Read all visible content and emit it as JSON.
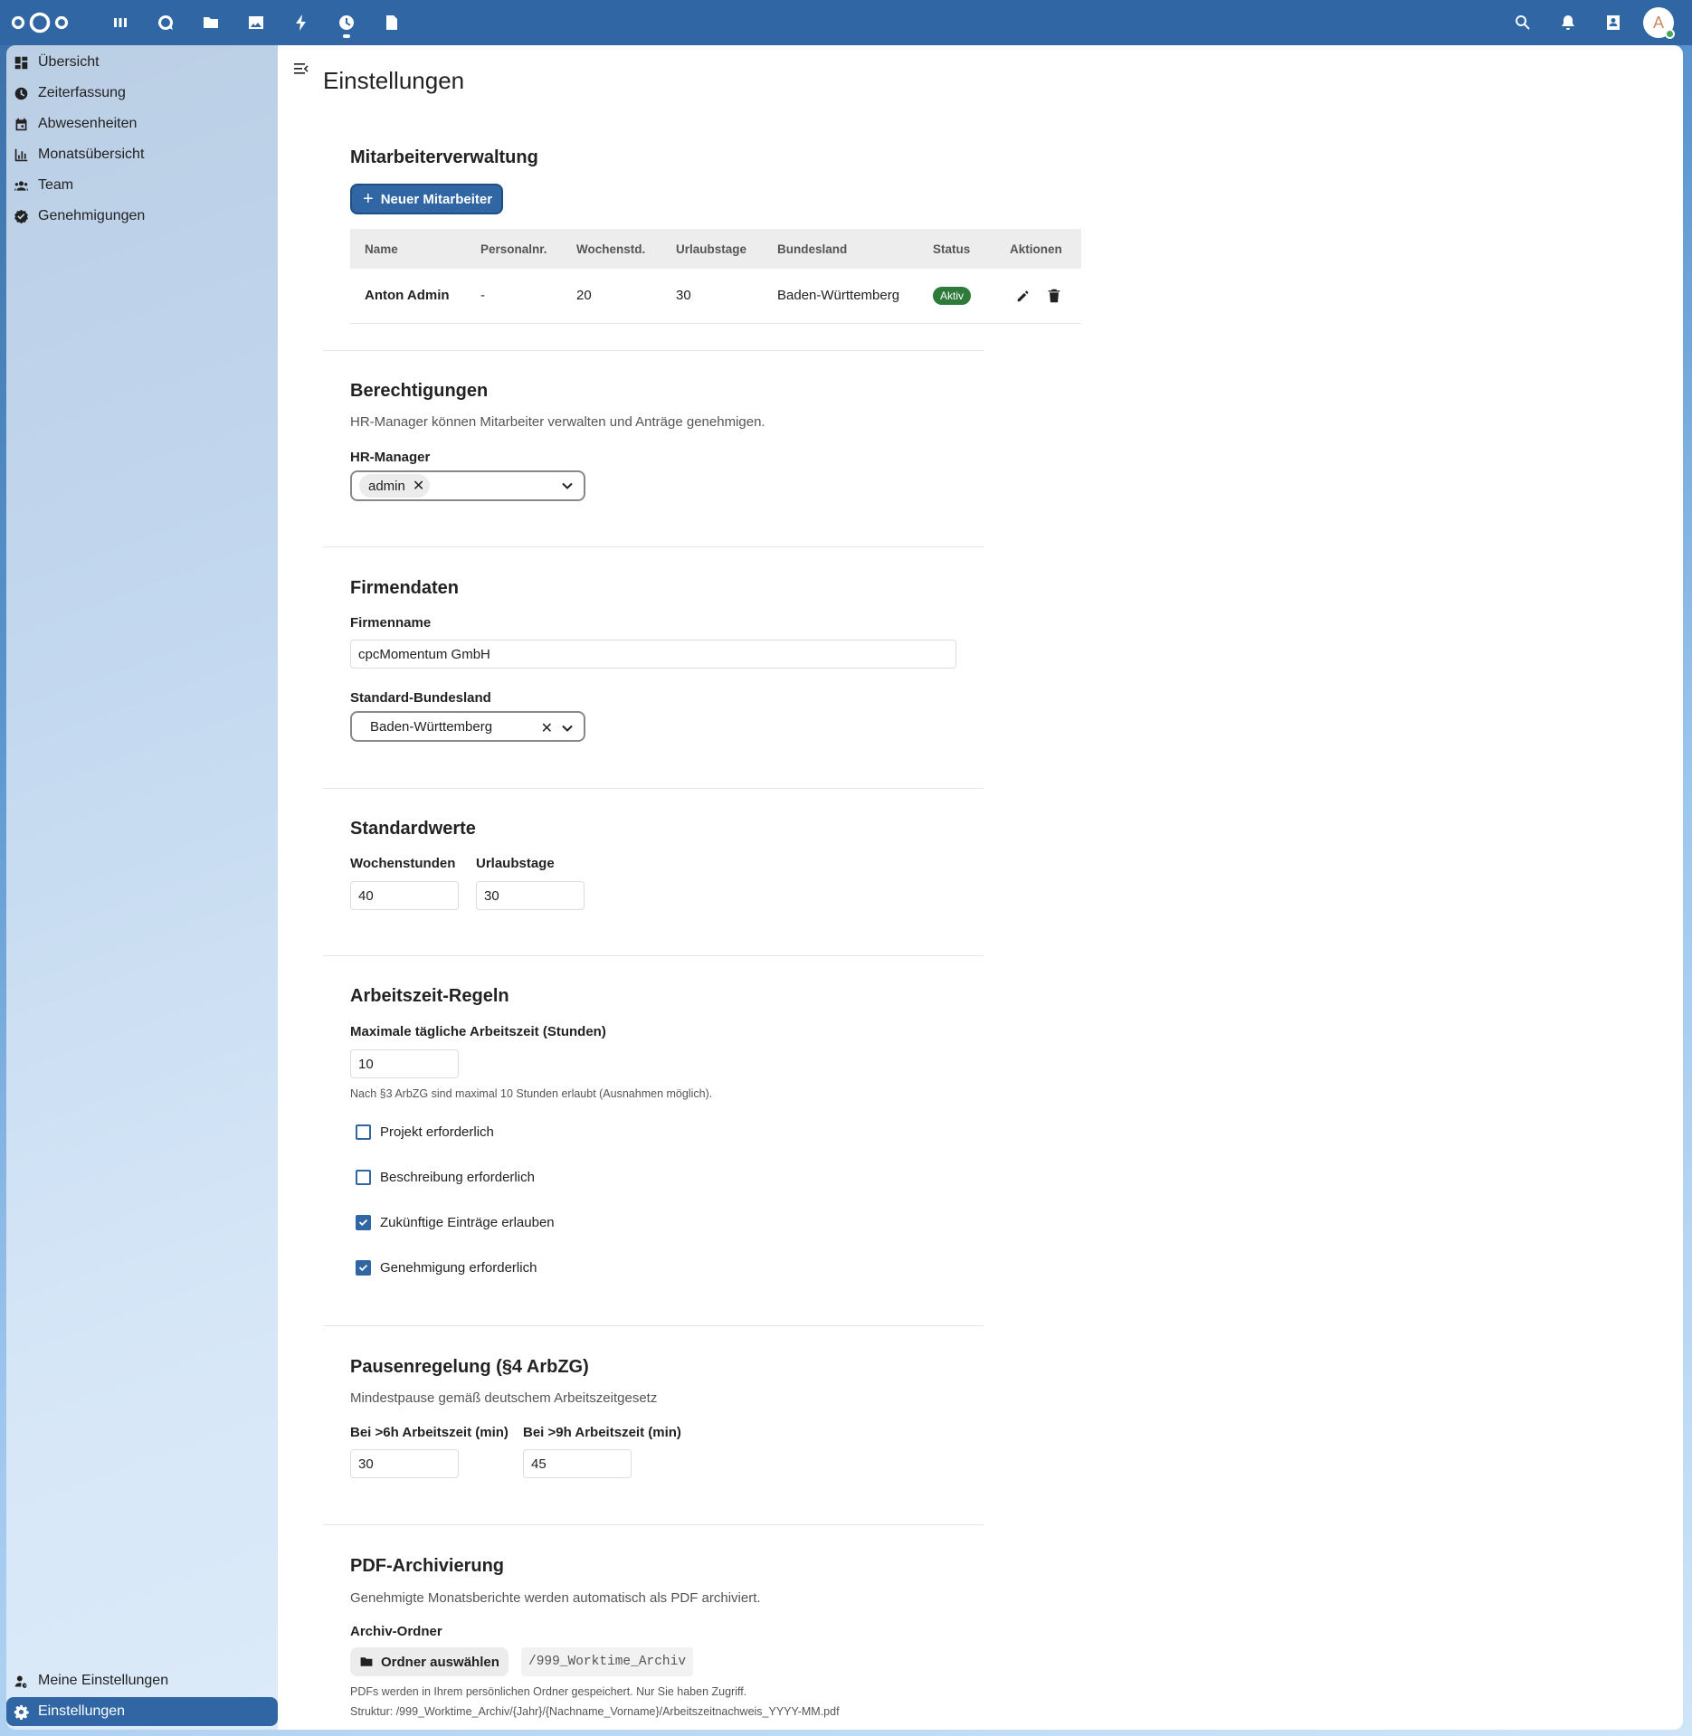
{
  "topbar": {
    "apps": [
      "dashboard-icon",
      "talk-icon",
      "files-icon",
      "photos-icon",
      "activity-icon",
      "timetracking-icon",
      "notes-icon"
    ],
    "active_app": "timetracking-icon",
    "avatar_initial": "A"
  },
  "sidebar": {
    "items": [
      {
        "label": "Übersicht",
        "icon": "dashboard-icon"
      },
      {
        "label": "Zeiterfassung",
        "icon": "clock-icon"
      },
      {
        "label": "Abwesenheiten",
        "icon": "calendar-icon"
      },
      {
        "label": "Monatsübersicht",
        "icon": "chart-icon"
      },
      {
        "label": "Team",
        "icon": "team-icon"
      },
      {
        "label": "Genehmigungen",
        "icon": "approval-icon"
      }
    ],
    "bottom": [
      {
        "label": "Meine Einstellungen",
        "icon": "user-settings-icon"
      },
      {
        "label": "Einstellungen",
        "icon": "gear-icon",
        "active": true
      }
    ]
  },
  "page": {
    "title": "Einstellungen"
  },
  "employees": {
    "title": "Mitarbeiterverwaltung",
    "new_button": "Neuer Mitarbeiter",
    "columns": [
      "Name",
      "Personalnr.",
      "Wochenstd.",
      "Urlaubstage",
      "Bundesland",
      "Status",
      "Aktionen"
    ],
    "rows": [
      {
        "name": "Anton Admin",
        "personalnr": "-",
        "wochenstd": "20",
        "urlaubstage": "30",
        "bundesland": "Baden-Württemberg",
        "status": "Aktiv"
      }
    ]
  },
  "permissions": {
    "title": "Berechtigungen",
    "description": "HR-Manager können Mitarbeiter verwalten und Anträge genehmigen.",
    "hr_label": "HR-Manager",
    "hr_chip": "admin"
  },
  "company": {
    "title": "Firmendaten",
    "name_label": "Firmenname",
    "name_value": "cpcMomentum GmbH",
    "state_label": "Standard-Bundesland",
    "state_value": "Baden-Württemberg"
  },
  "defaults": {
    "title": "Standardwerte",
    "hours_label": "Wochenstunden",
    "hours_value": "40",
    "vacation_label": "Urlaubstage",
    "vacation_value": "30"
  },
  "rules": {
    "title": "Arbeitszeit-Regeln",
    "max_label": "Maximale tägliche Arbeitszeit (Stunden)",
    "max_value": "10",
    "max_hint": "Nach §3 ArbZG sind maximal 10 Stunden erlaubt (Ausnahmen möglich).",
    "checkboxes": [
      {
        "label": "Projekt erforderlich",
        "checked": false
      },
      {
        "label": "Beschreibung erforderlich",
        "checked": false
      },
      {
        "label": "Zukünftige Einträge erlauben",
        "checked": true
      },
      {
        "label": "Genehmigung erforderlich",
        "checked": true
      }
    ]
  },
  "breaks": {
    "title": "Pausenregelung (§4 ArbZG)",
    "description": "Mindestpause gemäß deutschem Arbeitszeitgesetz",
    "six_label": "Bei >6h Arbeitszeit (min)",
    "six_value": "30",
    "nine_label": "Bei >9h Arbeitszeit (min)",
    "nine_value": "45"
  },
  "pdf": {
    "title": "PDF-Archivierung",
    "description": "Genehmigte Monatsberichte werden automatisch als PDF archiviert.",
    "folder_label": "Archiv-Ordner",
    "folder_button": "Ordner auswählen",
    "folder_path": "/999_Worktime_Archiv",
    "hint1": "PDFs werden in Ihrem persönlichen Ordner gespeichert. Nur Sie haben Zugriff.",
    "hint2": "Struktur: /999_Worktime_Archiv/{Jahr}/{Nachname_Vorname}/Arbeitszeitnachweis_YYYY-MM.pdf"
  }
}
